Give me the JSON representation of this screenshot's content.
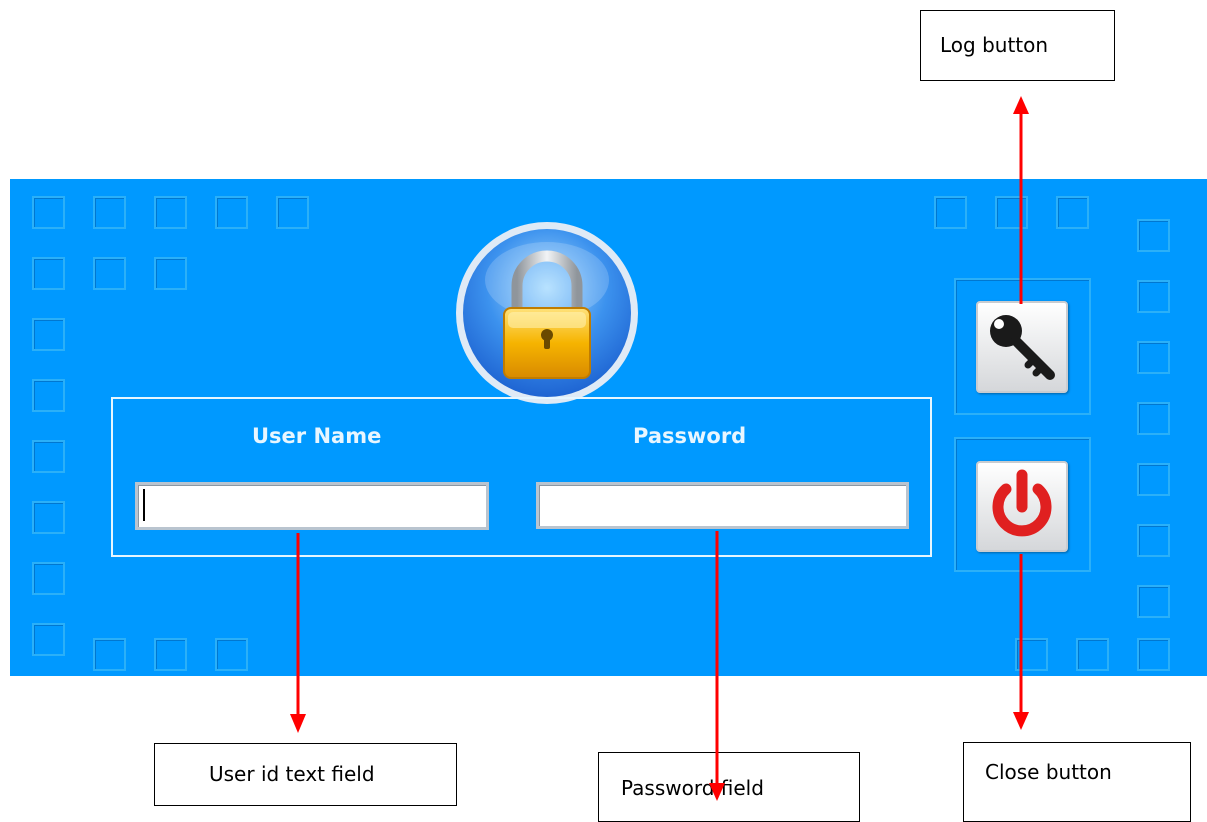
{
  "login_panel": {
    "user_label": "User Name",
    "password_label": "Password",
    "user_value": "",
    "password_value": ""
  },
  "callouts": {
    "log_button": "Log button",
    "user_field": "User id text field",
    "password_field": "Password field",
    "close_button": "Close button"
  },
  "icons": {
    "lock": "padlock-icon",
    "log": "key-icon",
    "close": "power-icon"
  },
  "colors": {
    "panel_background": "#0099ff",
    "arrow": "#ff0000",
    "power_icon": "#e02020",
    "lock_body": "#f6b400"
  }
}
